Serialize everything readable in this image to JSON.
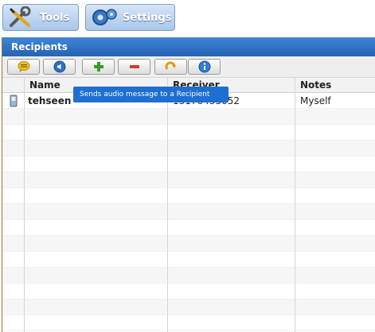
{
  "top_buttons": {
    "tools_label": "Tools",
    "settings_label": "Settings"
  },
  "panel": {
    "title": "Recipients"
  },
  "toolbar": {
    "buttons": [
      {
        "icon": "chat-bubble-icon"
      },
      {
        "icon": "speaker-icon"
      },
      {
        "icon": "add-icon"
      },
      {
        "icon": "remove-icon"
      },
      {
        "icon": "redo-icon"
      },
      {
        "icon": "info-icon"
      }
    ]
  },
  "tooltip": {
    "text": "Sends audio message to a Recipient"
  },
  "grid": {
    "columns": [
      "Name",
      "Receiver",
      "Notes"
    ],
    "rows": [
      {
        "icon": "phone-icon",
        "name": "tehseen",
        "receiver": "13176435052",
        "notes": "Myself"
      }
    ]
  },
  "colors": {
    "header_blue": "#2f6fc4",
    "tooltip_blue": "#1d6fd1",
    "add_green": "#3a9a2a",
    "remove_red": "#d33a2c"
  }
}
